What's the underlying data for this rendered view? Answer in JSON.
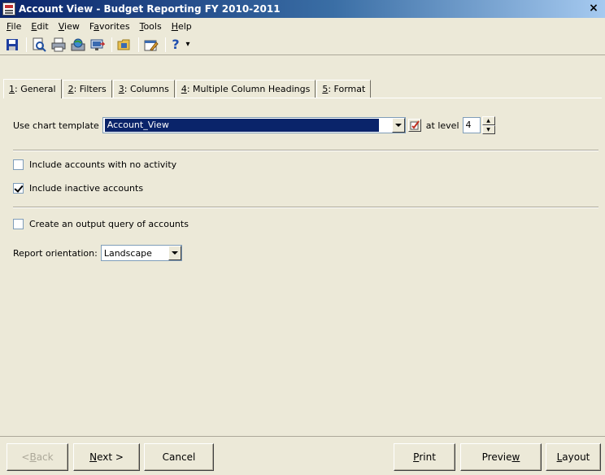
{
  "window": {
    "title": "Account View - Budget Reporting  FY 2010-2011",
    "close_glyph": "×"
  },
  "menu": {
    "items": [
      {
        "key": "F",
        "rest": "ile"
      },
      {
        "key": "E",
        "rest": "dit"
      },
      {
        "key": "V",
        "rest": "iew"
      },
      {
        "pre": "F",
        "key": "a",
        "rest": "vorites"
      },
      {
        "key": "T",
        "rest": "ools"
      },
      {
        "key": "H",
        "rest": "elp"
      }
    ]
  },
  "toolbar": {
    "icons": [
      "save-icon",
      "print-preview-icon",
      "print-icon",
      "globe-icon",
      "transfer-icon",
      "open-folder-icon",
      "properties-icon",
      "help-icon"
    ],
    "help_glyph": "?",
    "dropdown_glyph": "▾"
  },
  "tabs": [
    {
      "key": "1",
      "label": ": General"
    },
    {
      "key": "2",
      "label": ": Filters"
    },
    {
      "key": "3",
      "label": ": Columns"
    },
    {
      "key": "4",
      "label": ": Multiple Column Headings"
    },
    {
      "key": "5",
      "label": ": Format"
    }
  ],
  "general": {
    "chart_template_label": "Use chart template",
    "chart_template_value": "Account_View",
    "at_level_label": "at level",
    "level_value": "4",
    "include_no_activity_label": "Include accounts with no activity",
    "include_no_activity_checked": false,
    "include_inactive_label": "Include inactive accounts",
    "include_inactive_checked": true,
    "output_query_label": "Create an output query of accounts",
    "output_query_checked": false,
    "orientation_label": "Report orientation:",
    "orientation_value": "Landscape"
  },
  "buttons": {
    "back_pre": "< ",
    "back_key": "B",
    "back_rest": "ack",
    "next_key": "N",
    "next_rest": "ext >",
    "cancel": "Cancel",
    "print_key": "P",
    "print_rest": "rint",
    "preview_pre": "Previe",
    "preview_key": "w",
    "layout_key": "L",
    "layout_rest": "ayout"
  }
}
